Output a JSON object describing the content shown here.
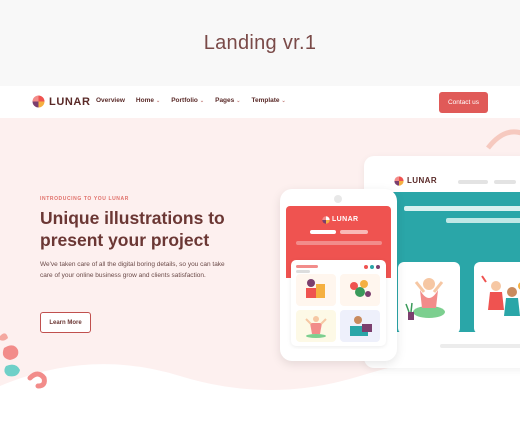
{
  "page_title": "Landing vr.1",
  "brand": {
    "name": "LUNAR",
    "accent": "#e05a58",
    "dark": "#5a2a28",
    "teal": "#2aa6a8"
  },
  "nav": {
    "items": [
      {
        "label": "Overview",
        "has_dropdown": false
      },
      {
        "label": "Home",
        "has_dropdown": true
      },
      {
        "label": "Portfolio",
        "has_dropdown": true
      },
      {
        "label": "Pages",
        "has_dropdown": true
      },
      {
        "label": "Template",
        "has_dropdown": true
      }
    ],
    "contact_label": "Contact us",
    "dropdown_glyph": "⌄"
  },
  "hero": {
    "kicker": "INTRODUCING TO YOU LUNAR",
    "headline": "Unique illustrations to present your project",
    "description": "We've taken care of all the digital boring details, so you can take care of your online business grow and clients satisfaction.",
    "cta_label": "Learn More"
  },
  "mockups": {
    "phone_brand": "LUNAR",
    "laptop_brand": "LUNAR"
  }
}
